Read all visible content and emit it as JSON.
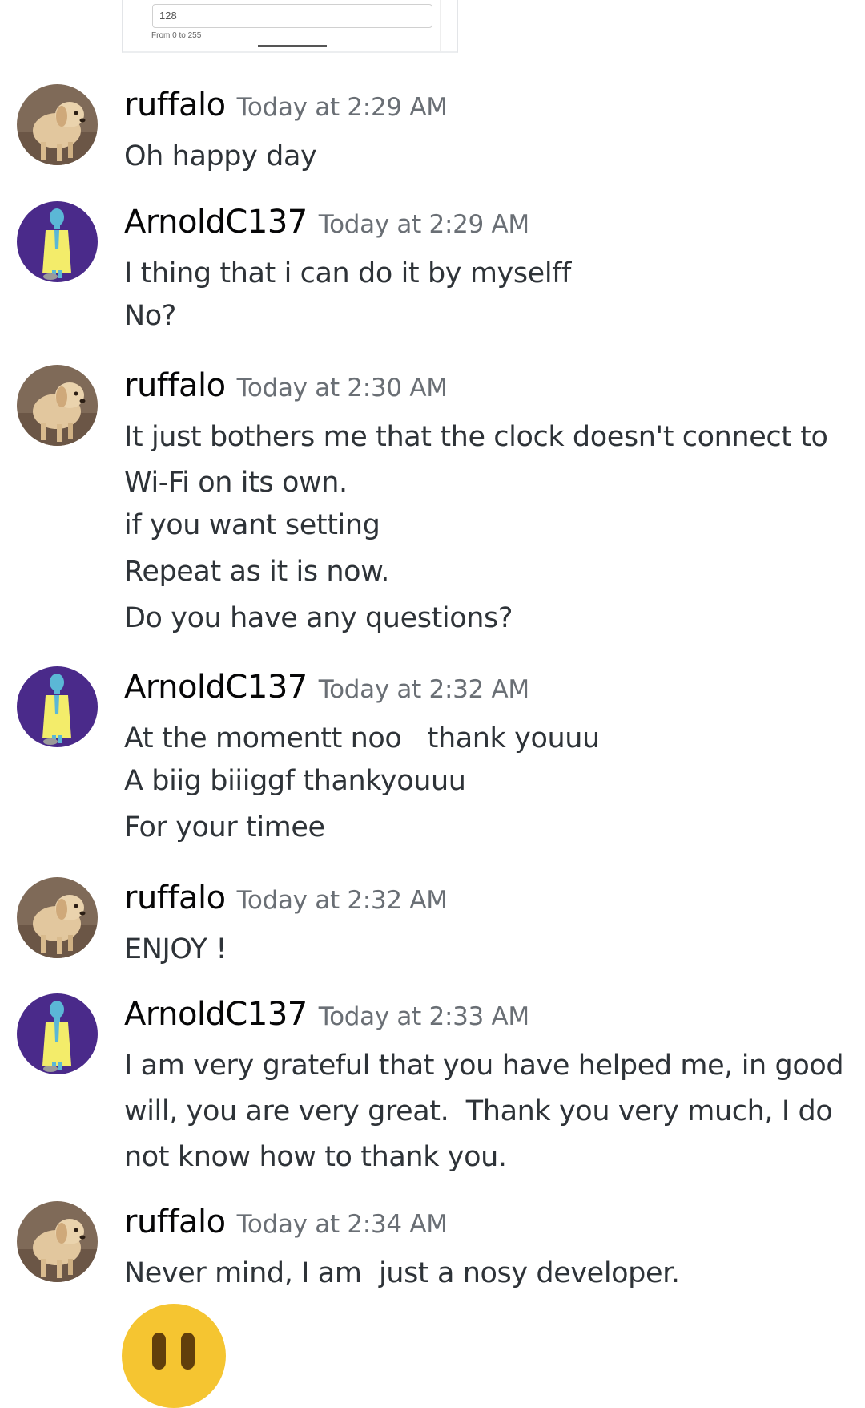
{
  "embed": {
    "input_value": "128",
    "hint": "From 0 to 255"
  },
  "messages": [
    {
      "author": "ruffalo",
      "timestamp": "Today at 2:29 AM",
      "avatar": "dog-avatar",
      "lines": [
        "Oh happy day"
      ]
    },
    {
      "author": "ArnoldC137",
      "timestamp": "Today at 2:29 AM",
      "avatar": "cartoon-man-avatar",
      "lines": [
        "I thing that i can do it by myselff",
        "No?"
      ]
    },
    {
      "author": "ruffalo",
      "timestamp": "Today at 2:30 AM",
      "avatar": "dog-avatar",
      "lines": [
        "It just bothers me that the clock doesn't connect to",
        "Wi-Fi on its own.",
        "if you want setting",
        "Repeat as it is now.",
        "Do you have any questions?"
      ]
    },
    {
      "author": "ArnoldC137",
      "timestamp": "Today at 2:32 AM",
      "avatar": "cartoon-man-avatar",
      "lines": [
        "At the momentt noo   thank youuu",
        "A biig biiiggf thankyouuu",
        "For your timee"
      ]
    },
    {
      "author": "ruffalo",
      "timestamp": "Today at 2:32 AM",
      "avatar": "dog-avatar",
      "lines": [
        "ENJOY !"
      ]
    },
    {
      "author": "ArnoldC137",
      "timestamp": "Today at 2:33 AM",
      "avatar": "cartoon-man-avatar",
      "lines": [
        "I am very grateful that you have helped me, in good",
        "will, you are very great.  Thank you very much, I do",
        "not know how to thank you."
      ]
    },
    {
      "author": "ruffalo",
      "timestamp": "Today at 2:34 AM",
      "avatar": "dog-avatar",
      "lines": [
        "Never mind, I am  just a nosy developer."
      ]
    }
  ],
  "trailing_emoji": "speechless-face-emoji",
  "colors": {
    "background": "#ffffff",
    "username": "#060607",
    "timestamp": "#6a6f75",
    "message_text": "#2e3338",
    "arnold_avatar_bg": "#4a2a8a",
    "emoji_yellow": "#f5c531"
  }
}
